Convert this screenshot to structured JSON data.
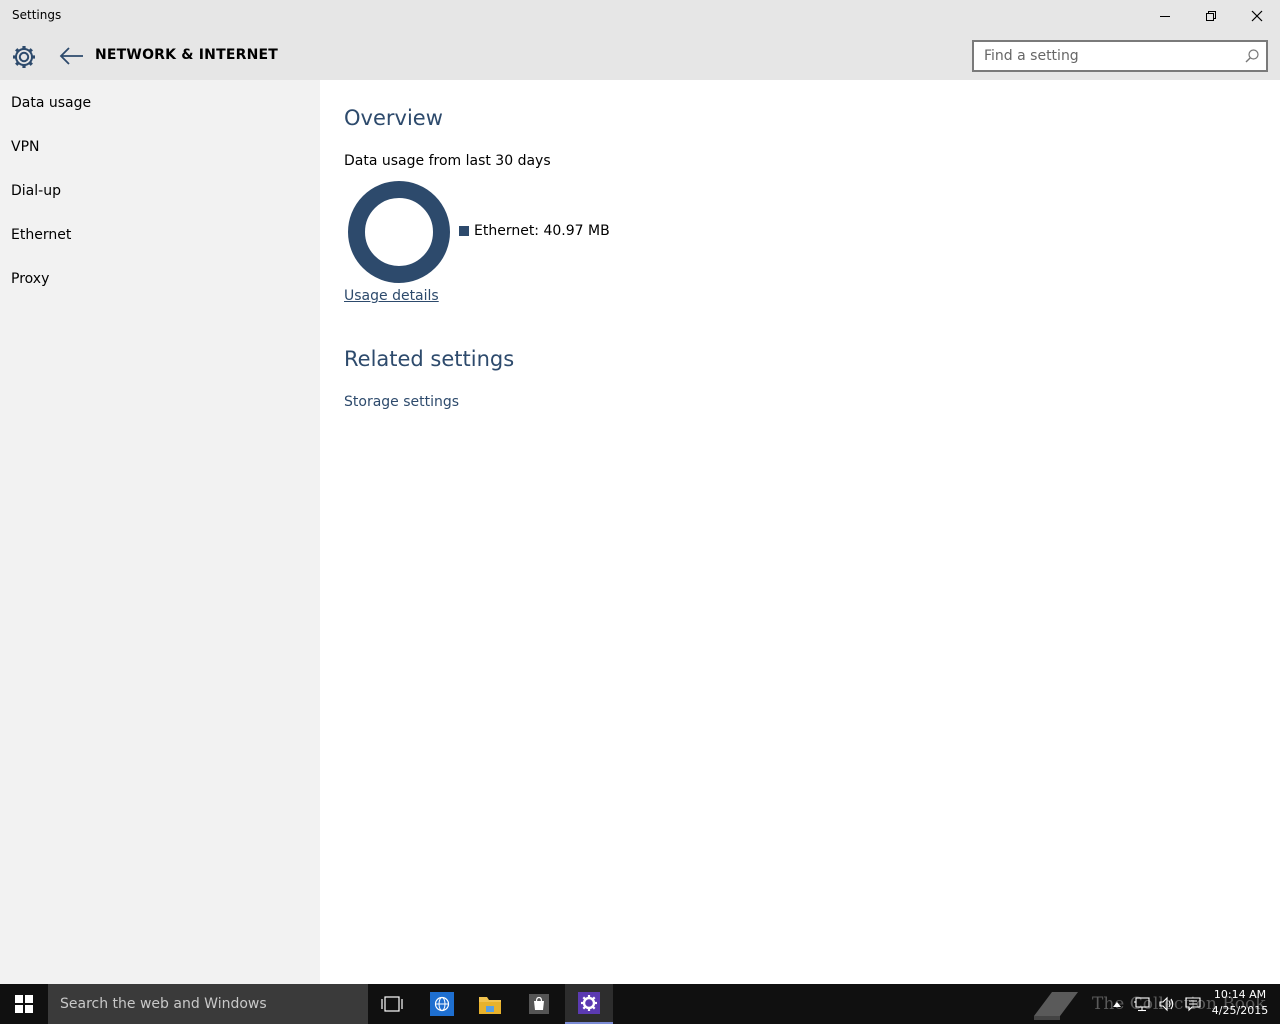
{
  "window": {
    "title": "Settings",
    "minimize_icon": "minimize-icon",
    "restore_icon": "restore-icon",
    "close_icon": "close-icon"
  },
  "header": {
    "section_title": "NETWORK & INTERNET",
    "search_placeholder": "Find a setting",
    "search_value": ""
  },
  "sidebar": {
    "items": [
      {
        "label": "Data usage"
      },
      {
        "label": "VPN"
      },
      {
        "label": "Dial-up"
      },
      {
        "label": "Ethernet"
      },
      {
        "label": "Proxy"
      }
    ]
  },
  "main": {
    "overview_heading": "Overview",
    "usage_subtitle": "Data usage from last 30 days",
    "legend_label": "Ethernet: 40.97 MB",
    "usage_details_link": "Usage details",
    "related_heading": "Related settings",
    "storage_link": "Storage settings"
  },
  "chart_data": {
    "type": "pie",
    "title": "",
    "categories": [
      "Ethernet"
    ],
    "values": [
      40.97
    ],
    "unit": "MB",
    "legend": "right"
  },
  "taskbar": {
    "search_placeholder": "Search the web and Windows",
    "watermark": "The Collection Book",
    "time": "10:14 AM",
    "date": "4/25/2015"
  },
  "colors": {
    "accent": "#2d4a6c",
    "titlebar": "#e6e6e6",
    "sidebar": "#f2f2f2",
    "taskbar": "#101010"
  }
}
